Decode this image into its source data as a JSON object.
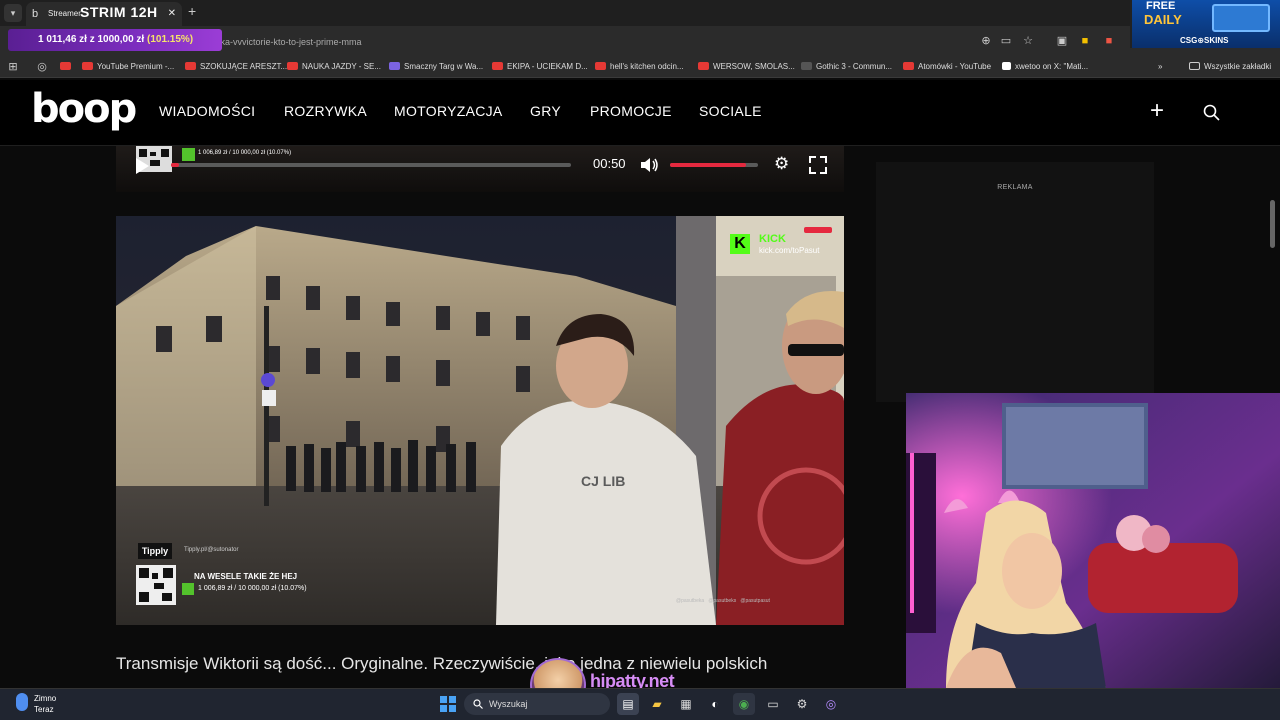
{
  "browser": {
    "tab_title": "Streamer",
    "stream_overlay_title": "STRIM 12H",
    "url": "amerka-vvvictorie-kto-to-jest-prime-mma",
    "new_tab_symbol": "+",
    "donation_goal": {
      "current": "1 011,46 zł",
      "separator": "z",
      "goal": "1000,00 zł",
      "percent": "(101.15%)"
    },
    "bookmarks": [
      {
        "label": "YouTube Premium -..."
      },
      {
        "label": "SZOKUJĄCE ARESZT..."
      },
      {
        "label": "NAUKA JAZDY - SE..."
      },
      {
        "label": "Smaczny Targ w Wa..."
      },
      {
        "label": "EKIPA - UCIEKAM D..."
      },
      {
        "label": "hell's kitchen odcin..."
      },
      {
        "label": "WERSOW, SMOLAS..."
      },
      {
        "label": "Gothic 3 - Commun..."
      },
      {
        "label": "Atomówki - YouTube"
      },
      {
        "label": "xwetoo on X: \"Mati..."
      },
      {
        "label": "Wszystkie zakładki"
      }
    ]
  },
  "ad_top": {
    "line1": "FREE",
    "line2": "DAILY",
    "brand": "CSG⊕SKINS"
  },
  "site": {
    "logo": "boop",
    "nav": [
      "WIADOMOŚCI",
      "ROZRYWKA",
      "MOTORYZACJA",
      "GRY",
      "PROMOCJE",
      "SOCIALE"
    ]
  },
  "player": {
    "time": "00:50",
    "progress_fraction": 0.02,
    "volume_fraction": 0.86,
    "overlay_donation": "1 006,89 zł / 10 000,00 zł (10.07%)"
  },
  "sidebar": {
    "ad_label": "REKLAMA"
  },
  "video": {
    "kick_brand": "KICK",
    "kick_url": "kick.com/toPasut",
    "tipply_label": "Tipply",
    "tipply_url": "Tipply.pl/@sutonator",
    "donation_message": "NA WESELE TAKIE ŻE HEJ",
    "donation_progress": "1 006,89 zł / 10 000,00 zł (10.07%)",
    "hoodie_text": "CJ LIB",
    "socials": [
      "@pasutbeka",
      "@pasutbeks",
      "@pasutpasut"
    ]
  },
  "article": {
    "text": "Transmisje Wiktorii są dość... Oryginalne. Rzeczywiście, jako jedna z niewielu polskich"
  },
  "overlay": {
    "brand": "hipatty.net"
  },
  "taskbar": {
    "weather_label": "Zimno",
    "weather_sub": "Teraz",
    "search_placeholder": "Wyszukaj"
  }
}
